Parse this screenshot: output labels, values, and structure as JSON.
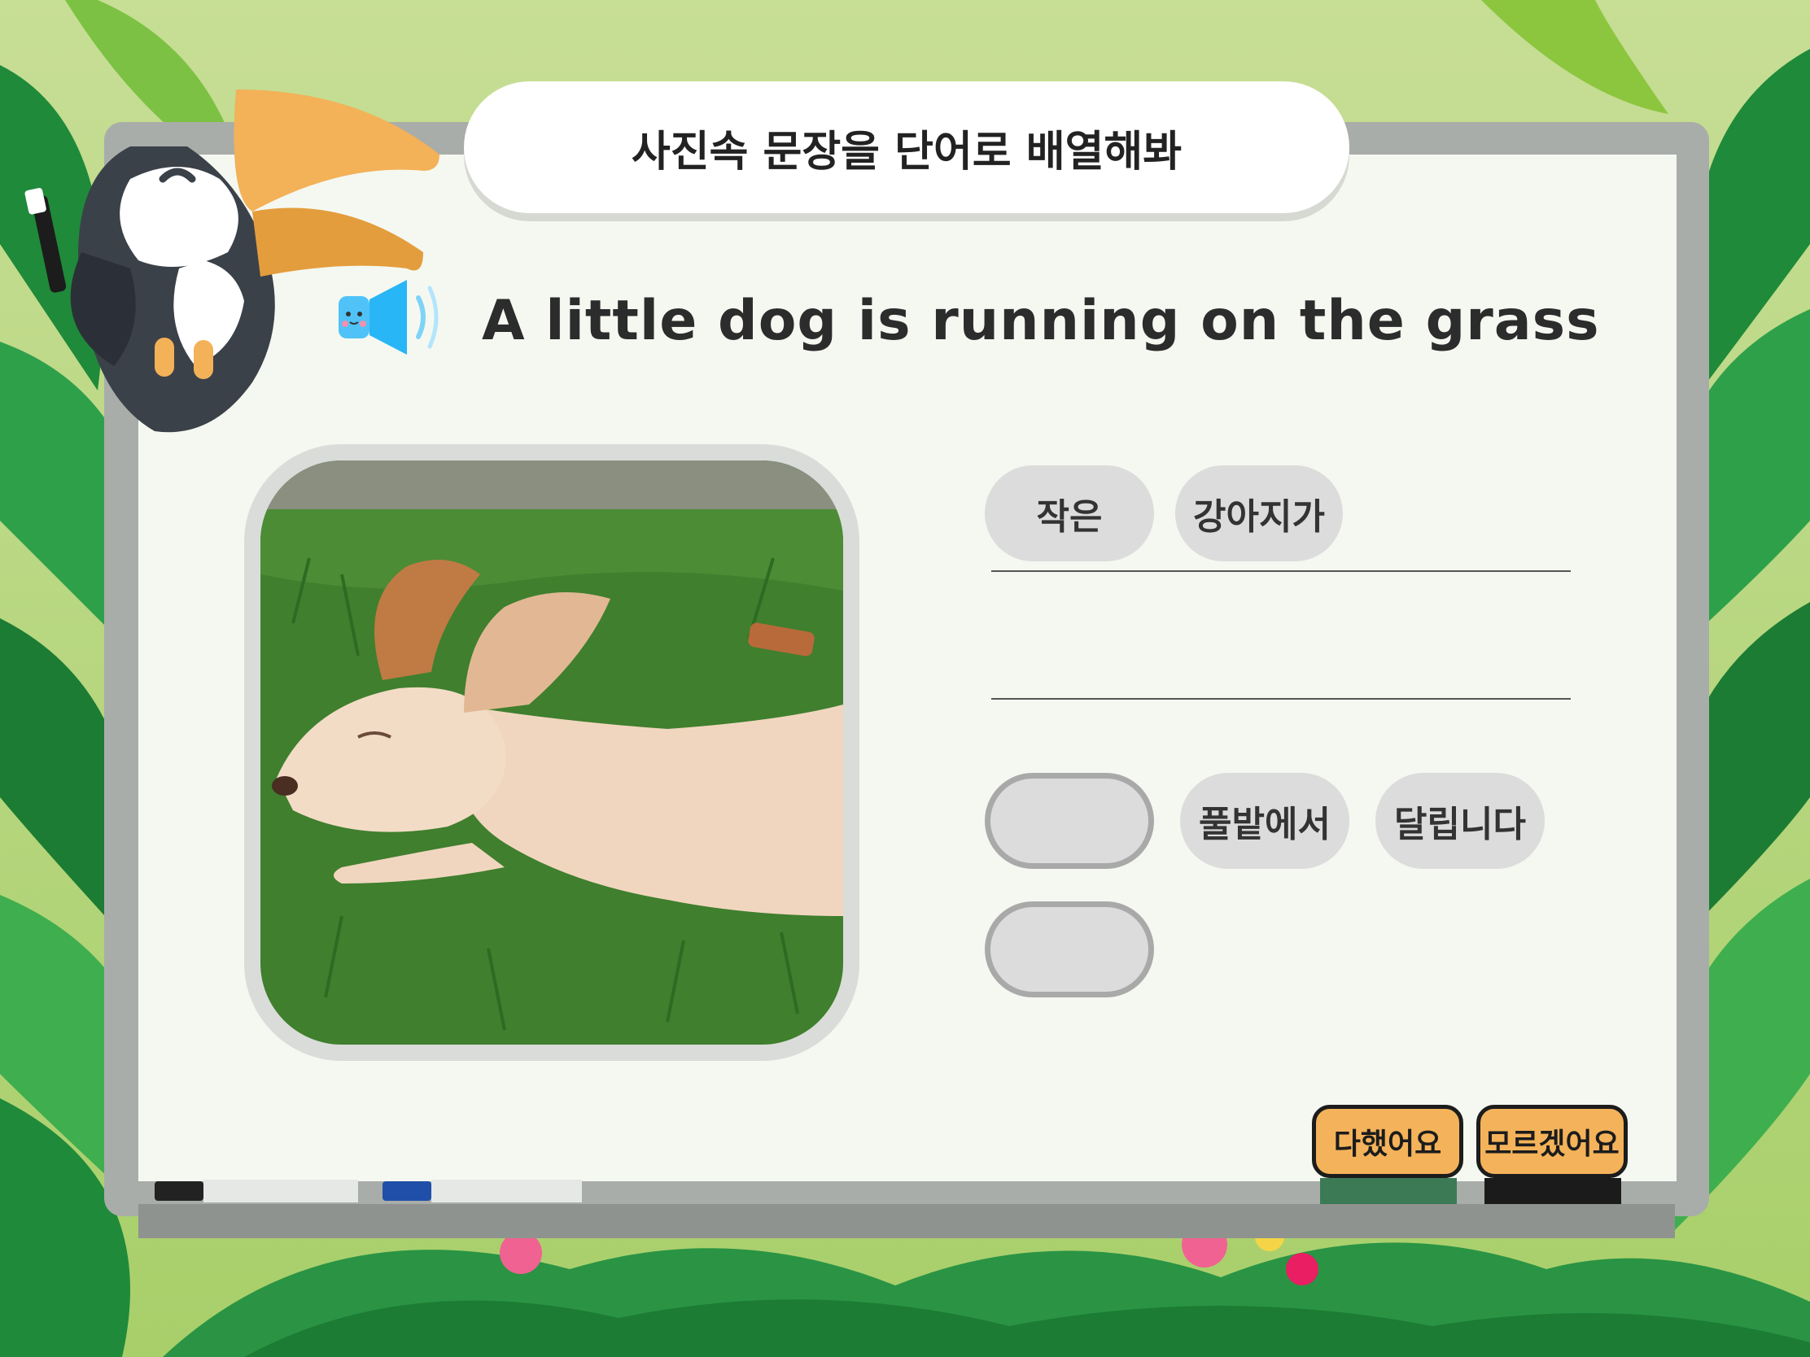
{
  "title": "사진속 문장을 단어로 배열해봐",
  "sentence": "A little dog is running on the grass",
  "icons": {
    "speaker": "speaker-icon",
    "mascot": "toucan-mascot",
    "photo": "dog-running-on-grass-photo"
  },
  "answer_chips": [
    {
      "label": "작은"
    },
    {
      "label": "강아지가"
    }
  ],
  "word_bank": [
    {
      "label": "",
      "state": "empty"
    },
    {
      "label": "풀밭에서"
    },
    {
      "label": "달립니다"
    },
    {
      "label": "",
      "state": "empty"
    }
  ],
  "buttons": {
    "done": "다했어요",
    "dont_know": "모르겠어요"
  },
  "colors": {
    "accent_button": "#f4b35a",
    "chip": "#dcdcdc",
    "board_frame": "#a9ada9",
    "leaf_dark": "#1f8a3a",
    "leaf_light": "#8cc63f"
  }
}
